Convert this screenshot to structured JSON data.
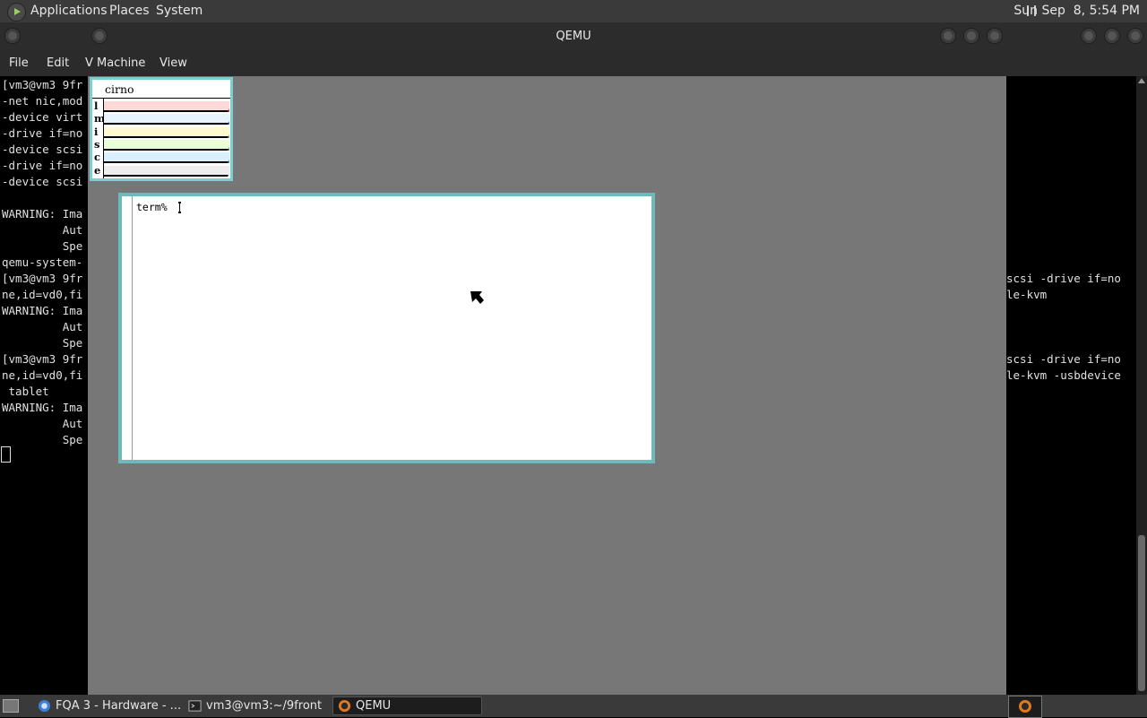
{
  "top_panel": {
    "menus": [
      "Applications",
      "Places",
      "System"
    ],
    "clock": "Sun Sep  8, 5:54 PM"
  },
  "window": {
    "title": "QEMU",
    "menus": [
      "File",
      "Edit",
      "Machine",
      "View"
    ],
    "partial_menu": "V"
  },
  "terminal": {
    "left_lines": [
      "[vm3@vm3 9fr",
      "-net nic,mod",
      "-device virt",
      "-drive if=no",
      "-device scsi",
      "-drive if=no",
      "-device scsi",
      "",
      "WARNING: Ima",
      "         Aut",
      "         Spe",
      "qemu-system-",
      "[vm3@vm3 9fr",
      "ne,id=vd0,fi",
      "WARNING: Ima",
      "         Aut",
      "         Spe",
      "[vm3@vm3 9fr",
      "ne,id=vd0,fi",
      " tablet",
      "WARNING: Ima",
      "         Aut",
      "         Spe"
    ],
    "right_lines": [
      {
        "row": 12,
        "text": "scsi -drive if=no"
      },
      {
        "row": 13,
        "text": "le-kvm"
      },
      {
        "row": 17,
        "text": "scsi -drive if=no"
      },
      {
        "row": 18,
        "text": "le-kvm -usbdevice"
      }
    ]
  },
  "guest": {
    "stats": {
      "hostname": "cirno",
      "rows": [
        {
          "letter": "l",
          "fill": "#ffd8d8",
          "tip": "#c04040"
        },
        {
          "letter": "m",
          "fill": "#e8f4ff",
          "tip": "#4060c0"
        },
        {
          "letter": "i",
          "fill": "#fffad0",
          "tip": "#a0a040"
        },
        {
          "letter": "s",
          "fill": "#e8ffd8",
          "tip": "#40a040"
        },
        {
          "letter": "c",
          "fill": "#d8f0ff",
          "tip": "#3090c0"
        },
        {
          "letter": "e",
          "fill": "#eeeeee",
          "tip": "#eeeeee"
        }
      ]
    },
    "term": {
      "prompt": "term%"
    }
  },
  "taskbar": {
    "tasks": [
      {
        "label": "FQA 3 - Hardware - ...",
        "icon": "browser-icon"
      },
      {
        "label": "vm3@vm3:~/9front",
        "icon": "terminal-icon"
      },
      {
        "label": "QEMU",
        "icon": "qemu-icon"
      }
    ]
  }
}
